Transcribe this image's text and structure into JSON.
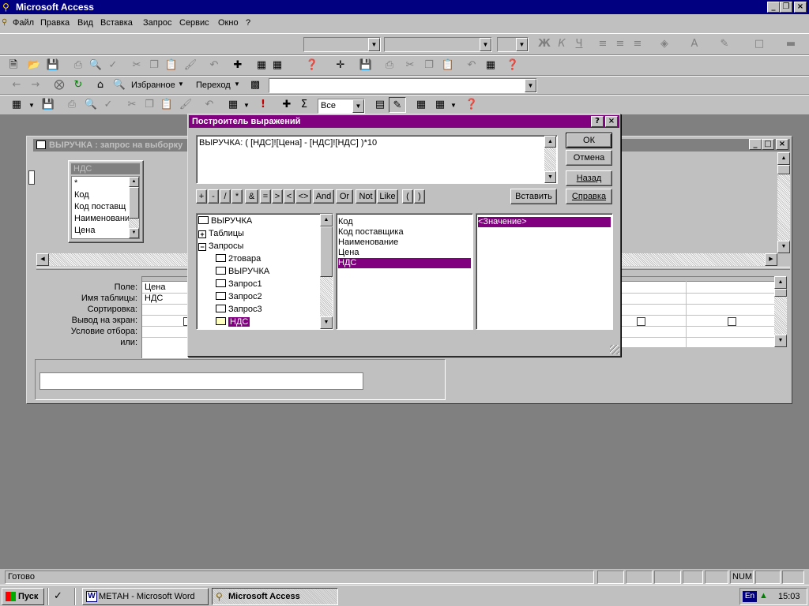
{
  "app": {
    "title": "Microsoft Access"
  },
  "menu": [
    "Файл",
    "Правка",
    "Вид",
    "Вставка",
    "Запрос",
    "Сервис",
    "Окно",
    "?"
  ],
  "web_toolbar": {
    "favorites": "Избранное",
    "goto": "Переход"
  },
  "query_toolbar": {
    "top_values": "Все"
  },
  "query_window": {
    "title": "ВЫРУЧКА : запрос на выборку",
    "table_box": {
      "title": "НДС",
      "fields": [
        "*",
        "Код",
        "Код поставщ",
        "Наименовани",
        "Цена"
      ]
    },
    "grid_labels": [
      "Поле:",
      "Имя таблицы:",
      "Сортировка:",
      "Вывод на экран:",
      "Условие отбора:",
      "или:"
    ],
    "column1": {
      "field": "Цена",
      "table": "НДС"
    }
  },
  "dialog": {
    "title": "Построитель выражений",
    "expression": "ВЫРУЧКА: ( [НДС]![Цена] - [НДС]![НДС] )*10",
    "buttons": {
      "ok": "ОК",
      "cancel": "Отмена",
      "back": "Назад",
      "paste": "Вставить",
      "help": "Справка"
    },
    "operators": [
      "+",
      "-",
      "/",
      "*",
      "&",
      "=",
      ">",
      "<",
      "<>",
      "And",
      "Or",
      "Not",
      "Like",
      "(",
      ")"
    ],
    "tree": [
      "ВЫРУЧКА",
      "Таблицы",
      "Запросы",
      "2товара",
      "ВЫРУЧКА",
      "Запрос1",
      "Запрос2",
      "Запрос3",
      "НДС"
    ],
    "fields": [
      "Код",
      "Код поставщика",
      "Наименование",
      "Цена",
      "НДС"
    ],
    "values": [
      "<Значение>"
    ]
  },
  "status": {
    "text": "Готово",
    "num": "NUM"
  },
  "taskbar": {
    "start": "Пуск",
    "task_word": "МЕТАН - Microsoft Word",
    "task_access": "Microsoft Access",
    "lang": "En",
    "clock": "15:03"
  },
  "colors": {
    "titlebar_active": "#000080",
    "dialog_title": "#800080",
    "selection": "#800080",
    "face": "#c0c0c0"
  }
}
